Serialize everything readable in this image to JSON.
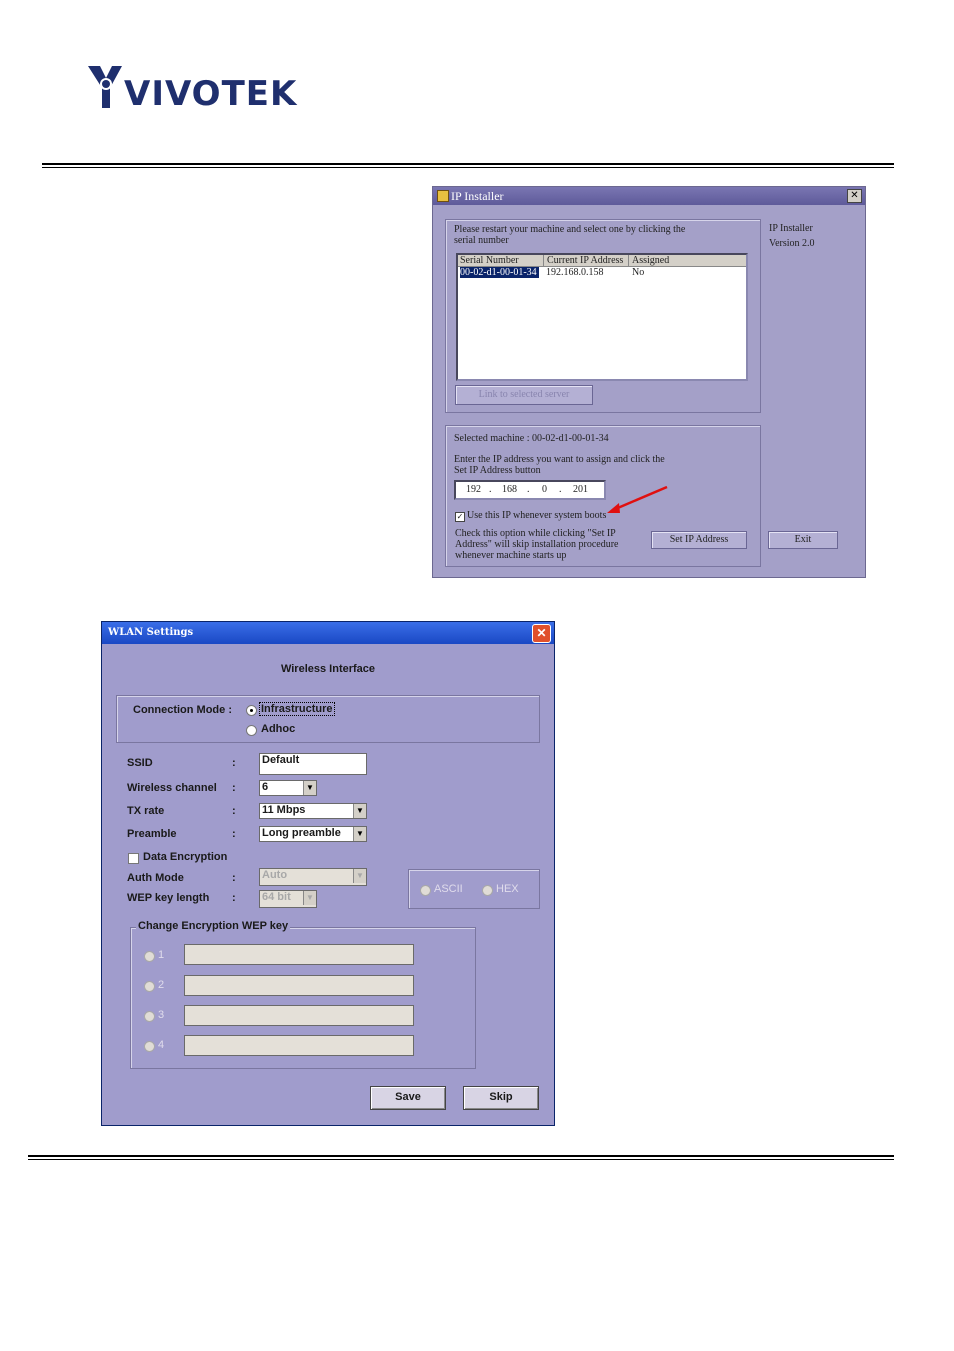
{
  "logo": {
    "text": "VIVOTEK"
  },
  "ip_installer": {
    "title": "IP Installer",
    "close_glyph": "✕",
    "instruction": "Please restart your machine and select one by clicking the serial number",
    "columns": [
      "Serial Number",
      "Current IP Address",
      "Assigned"
    ],
    "rows": [
      {
        "serial": "00-02-d1-00-01-34",
        "ip": "192.168.0.158",
        "assigned": "No"
      }
    ],
    "link_button": "Link to selected server",
    "app_name": "IP Installer",
    "version": "Version 2.0",
    "selected_machine": "Selected machine : 00-02-d1-00-01-34",
    "enter_ip_text": "Enter the IP address you want to assign and click the Set IP Address button",
    "ip_octets": [
      "192",
      "168",
      "0",
      "201"
    ],
    "ip_dot": ".",
    "use_ip_checkbox": "Use this IP whenever system boots",
    "check_note": "Check this option while clicking \"Set IP Address\" will skip installation procedure whenever machine starts up",
    "set_ip_button": "Set IP Address",
    "exit_button": "Exit",
    "arrow_color": "#e01010"
  },
  "wlan": {
    "title": "WLAN Settings",
    "close_glyph": "✕",
    "heading": "Wireless Interface",
    "connection_mode_label": "Connection Mode :",
    "modes": [
      "Infrastructure",
      "Adhoc"
    ],
    "colon": ":",
    "ssid_label": "SSID",
    "ssid_value": "Default",
    "channel_label": "Wireless channel",
    "channel_value": "6",
    "tx_label": "TX rate",
    "tx_value": "11 Mbps",
    "preamble_label": "Preamble",
    "preamble_value": "Long preamble",
    "data_encryption_label": "Data Encryption",
    "auth_mode_label": "Auth Mode",
    "auth_mode_value": "Auto",
    "wep_length_label": "WEP key length",
    "wep_length_value": "64 bit",
    "key_formats": [
      "ASCII",
      "HEX"
    ],
    "wep_group_label": "Change Encryption WEP key",
    "wep_keys": [
      "1",
      "2",
      "3",
      "4"
    ],
    "save_button": "Save",
    "skip_button": "Skip",
    "dropdown_glyph": "▼"
  }
}
